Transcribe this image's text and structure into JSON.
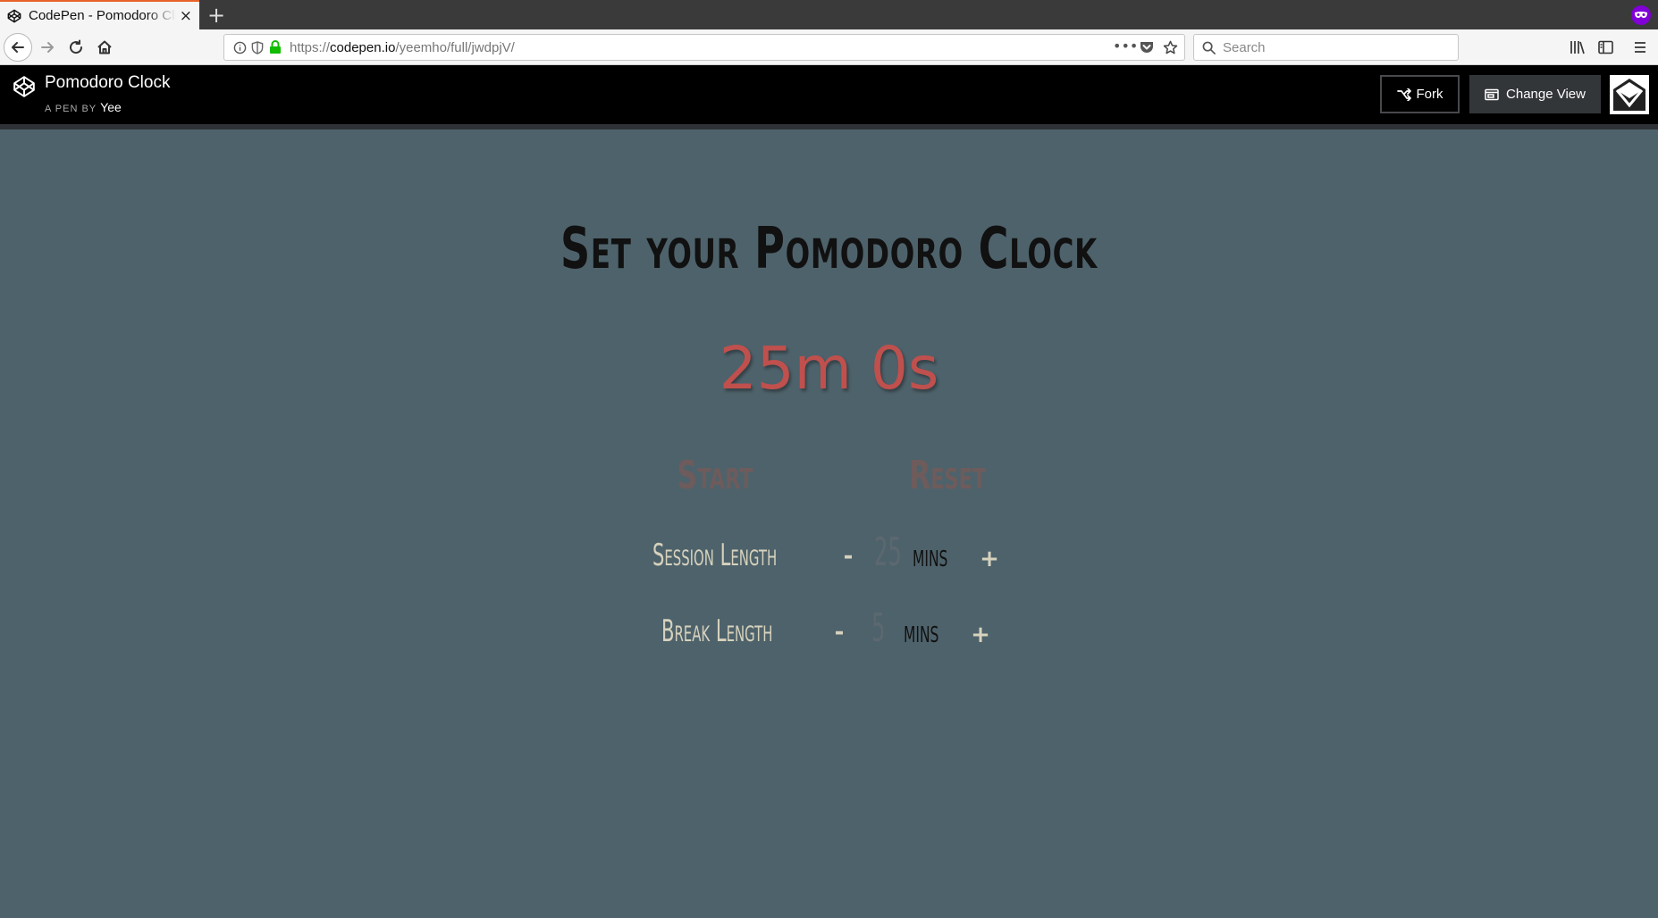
{
  "browser": {
    "tab_title": "CodePen - Pomodoro Clock",
    "new_tab_label": "+",
    "close_label": "×",
    "url_prefix": "https://",
    "url_host": "codepen.io",
    "url_path": "/yeemho/full/jwdpjV/",
    "search_placeholder": "Search",
    "accent_color": "#e8622a",
    "private_badge_color": "#8000d7"
  },
  "codepen": {
    "pen_title": "Pomodoro Clock",
    "by_label": "A PEN BY",
    "author": "Yee",
    "fork_label": "Fork",
    "change_view_label": "Change View"
  },
  "app": {
    "title": "Set your Pomodoro Clock",
    "timer": "25m 0s",
    "start_label": "Start",
    "reset_label": "Reset",
    "session": {
      "label": "Session Length",
      "minus": "-",
      "value": "25",
      "unit": "mins",
      "plus": "+"
    },
    "break": {
      "label": "Break Length",
      "minus": "-",
      "value": "5",
      "unit": "mins",
      "plus": "+"
    },
    "colors": {
      "background": "#4e626b",
      "timer": "#c0504d",
      "title": "#111111",
      "labels": "#d6d2bd"
    }
  }
}
